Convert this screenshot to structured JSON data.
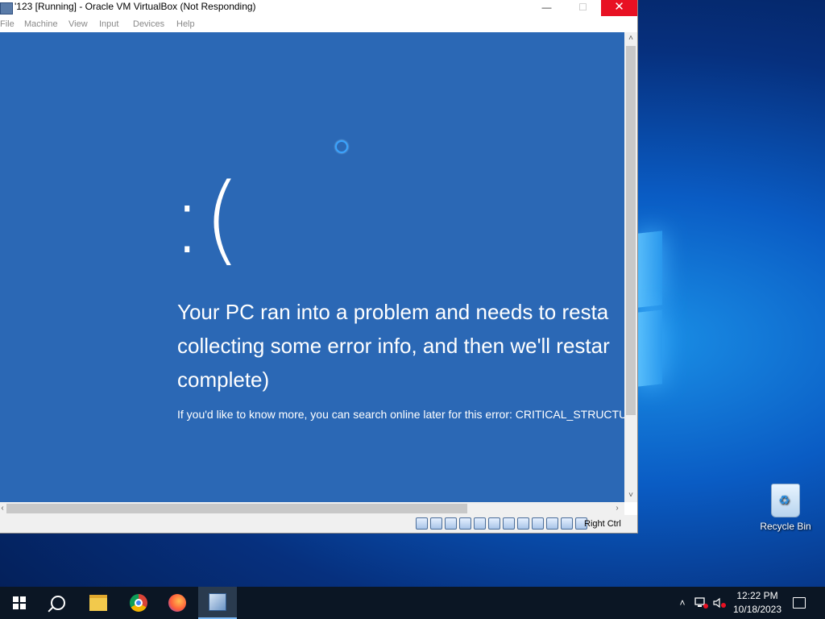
{
  "vm_window": {
    "title": "'123 [Running] - Oracle VM VirtualBox (Not Responding)",
    "controls": {
      "minimize": "—",
      "maximize": "☐",
      "close": "✕"
    },
    "menu": [
      "File",
      "Machine",
      "View",
      "Input",
      "Devices",
      "Help"
    ],
    "status_host_key": "Right Ctrl",
    "scroll_arrows": {
      "up": "˄",
      "down": "˅",
      "left": "‹",
      "right": "›"
    }
  },
  "bsod": {
    "face": ":(",
    "message_lines": [
      "Your PC ran into a problem and needs to resta",
      "collecting some error info, and then we'll restar",
      "complete)"
    ],
    "info": "If you'd like to know more, you can search online later for this error: CRITICAL_STRUCTU"
  },
  "desktop": {
    "recycle_bin_label": "Recycle Bin"
  },
  "taskbar": {
    "pinned": [
      "start-icon",
      "search-icon",
      "file-explorer-icon",
      "chrome-icon",
      "firefox-icon",
      "virtualbox-icon"
    ],
    "tray": {
      "chevron": "˄"
    },
    "clock_time": "12:22 PM",
    "clock_date": "10/18/2023"
  }
}
